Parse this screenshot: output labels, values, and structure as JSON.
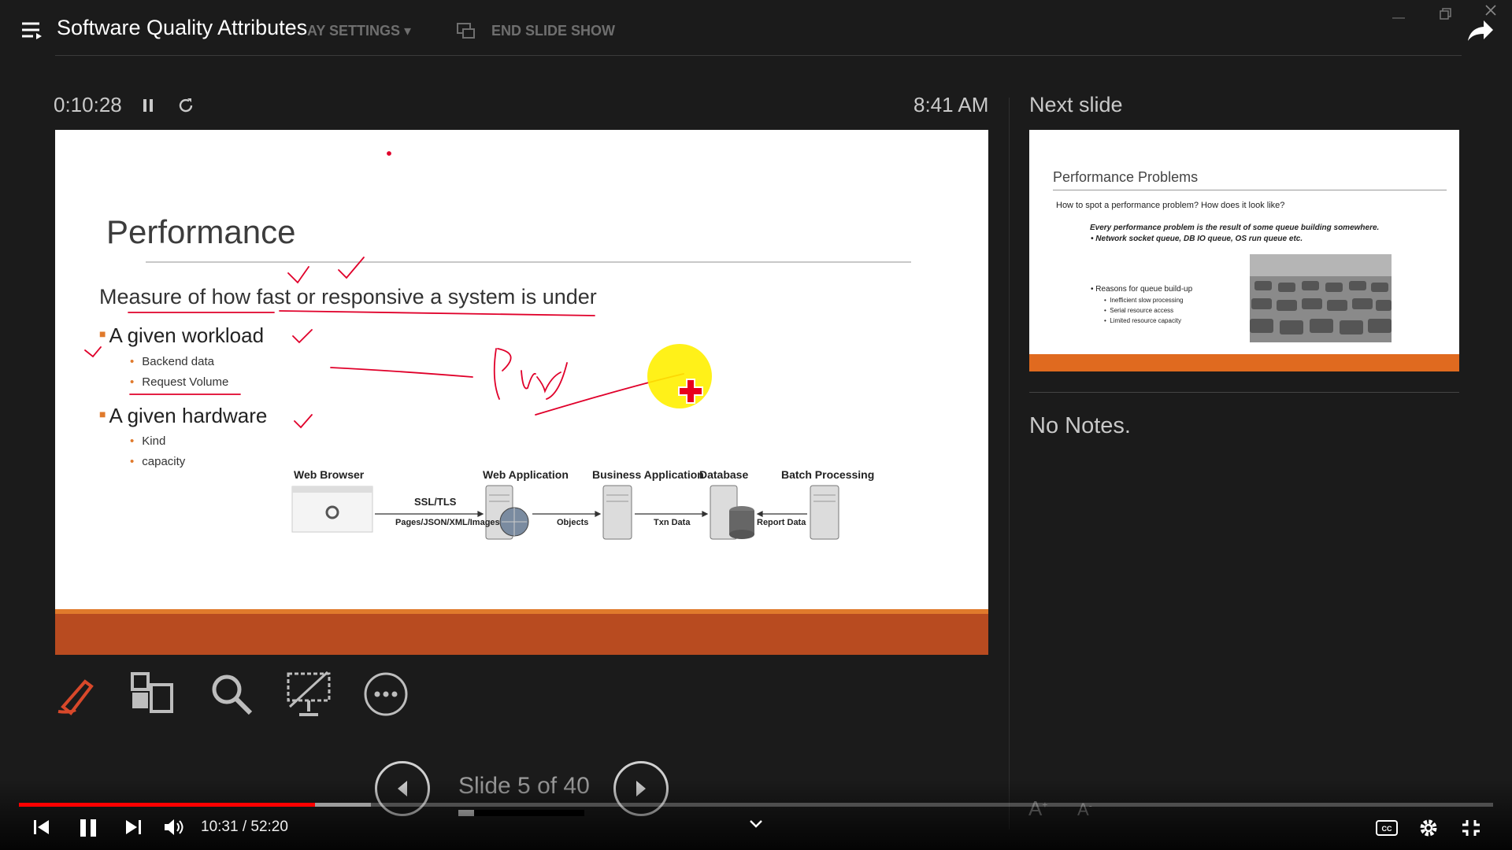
{
  "video": {
    "title": "Software Quality Attributes",
    "current_time": "10:31",
    "separator": "/",
    "duration": "52:20",
    "progress_fraction": 0.201,
    "buffered_fraction": 0.239,
    "accent_color": "#ff0000"
  },
  "presenter": {
    "menu": {
      "display_settings": "AY SETTINGS ▾",
      "end_show": "END SLIDE SHOW"
    },
    "timer": "0:10:28",
    "clock": "8:41 AM",
    "next_slide_label": "Next slide",
    "notes": "No Notes.",
    "slide_counter": "Slide 5 of 40",
    "slide_index": 5,
    "slide_total": 40,
    "tools": [
      "pen-icon",
      "see-all-slides-icon",
      "zoom-icon",
      "black-screen-icon",
      "more-icon"
    ],
    "accent_color": "#b84b20"
  },
  "slide": {
    "title": "Performance",
    "definition": "Measure of how fast or responsive a system is under",
    "bullets": [
      {
        "text": "A given workload",
        "subs": [
          "Backend data",
          "Request Volume"
        ]
      },
      {
        "text": "A given hardware",
        "subs": [
          "Kind",
          "capacity"
        ]
      }
    ],
    "diagram": {
      "nodes": [
        "Web Browser",
        "Web Application",
        "Business Application",
        "Database",
        "Batch Processing"
      ],
      "links": [
        "SSL/TLS",
        "Pages/JSON/XML/Images",
        "Objects",
        "Txn Data",
        "Report Data"
      ]
    }
  },
  "next_slide": {
    "title": "Performance Problems",
    "question": "How to spot a performance problem? How does it look like?",
    "emphasis": "Every performance problem is the result of some queue building somewhere.",
    "emphasis_sub": "•  Network socket queue, DB IO queue, OS run queue etc.",
    "reasons_title": "•  Reasons for queue build-up",
    "reasons": [
      "Inefficient slow processing",
      "Serial resource access",
      "Limited resource capacity"
    ]
  }
}
